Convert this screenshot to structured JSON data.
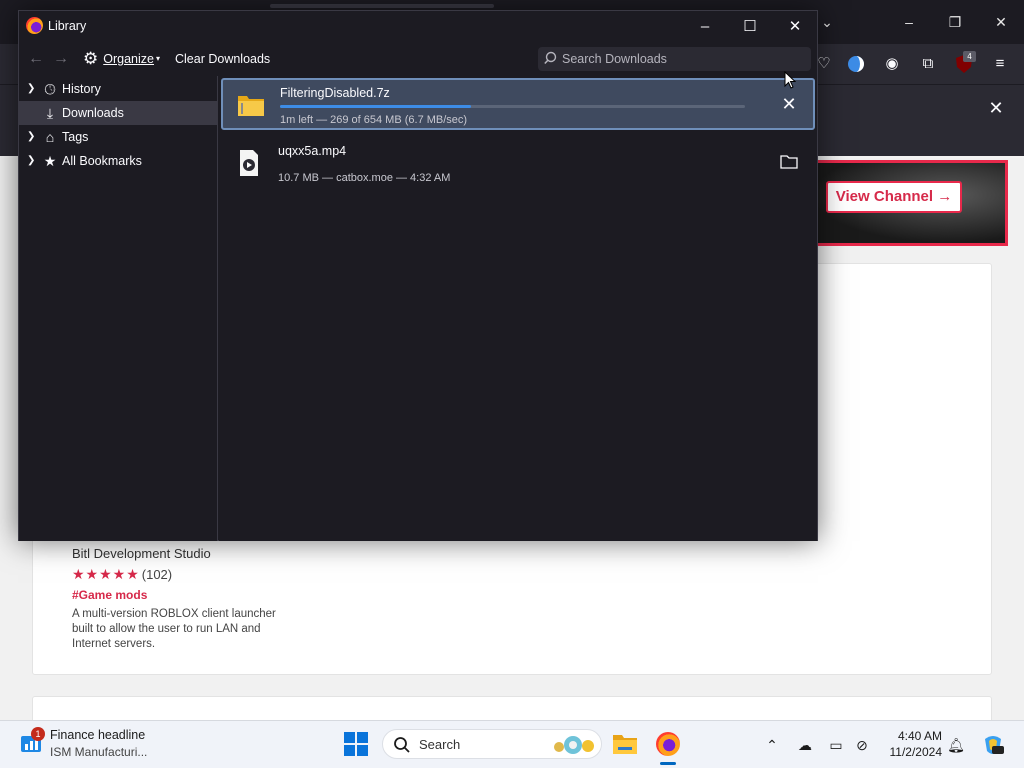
{
  "library": {
    "title": "Library",
    "toolbar": {
      "organize_label": "Organize",
      "clear_downloads_label": "Clear Downloads",
      "search_placeholder": "Search Downloads"
    },
    "sidebar": [
      {
        "label": "History",
        "icon": "clock-icon",
        "expandable": true
      },
      {
        "label": "Downloads",
        "icon": "download-icon",
        "expandable": false,
        "selected": true
      },
      {
        "label": "Tags",
        "icon": "tag-icon",
        "expandable": true
      },
      {
        "label": "All Bookmarks",
        "icon": "star-icon",
        "expandable": true
      }
    ],
    "downloads": [
      {
        "name": "FilteringDisabled.7z",
        "status": "1m left — 269 of 654 MB (6.7 MB/sec)",
        "progress": 0.41,
        "icon": "archive-icon",
        "action": "cancel-icon",
        "selected": true
      },
      {
        "name": "uqxx5a.mp4",
        "status": "10.7 MB — catbox.moe — 4:32 AM",
        "icon": "video-file-icon",
        "action": "folder-icon"
      }
    ]
  },
  "background_page": {
    "view_channel_label": "View Channel →",
    "card": {
      "author": "Bitl Development Studio",
      "rating_stars": "★★★★★",
      "rating_count": "(102)",
      "tag": "#Game mods",
      "description": "A multi-version ROBLOX client launcher built to allow the user to run LAN and Internet servers."
    },
    "ublock_badge": "4",
    "accent_color": "#e8294b"
  },
  "taskbar": {
    "widget_badge": "1",
    "widget_title": "Finance headline",
    "widget_subtitle": "ISM Manufacturi...",
    "search_label": "Search",
    "clock_time": "4:40 AM",
    "clock_date": "11/2/2024"
  }
}
